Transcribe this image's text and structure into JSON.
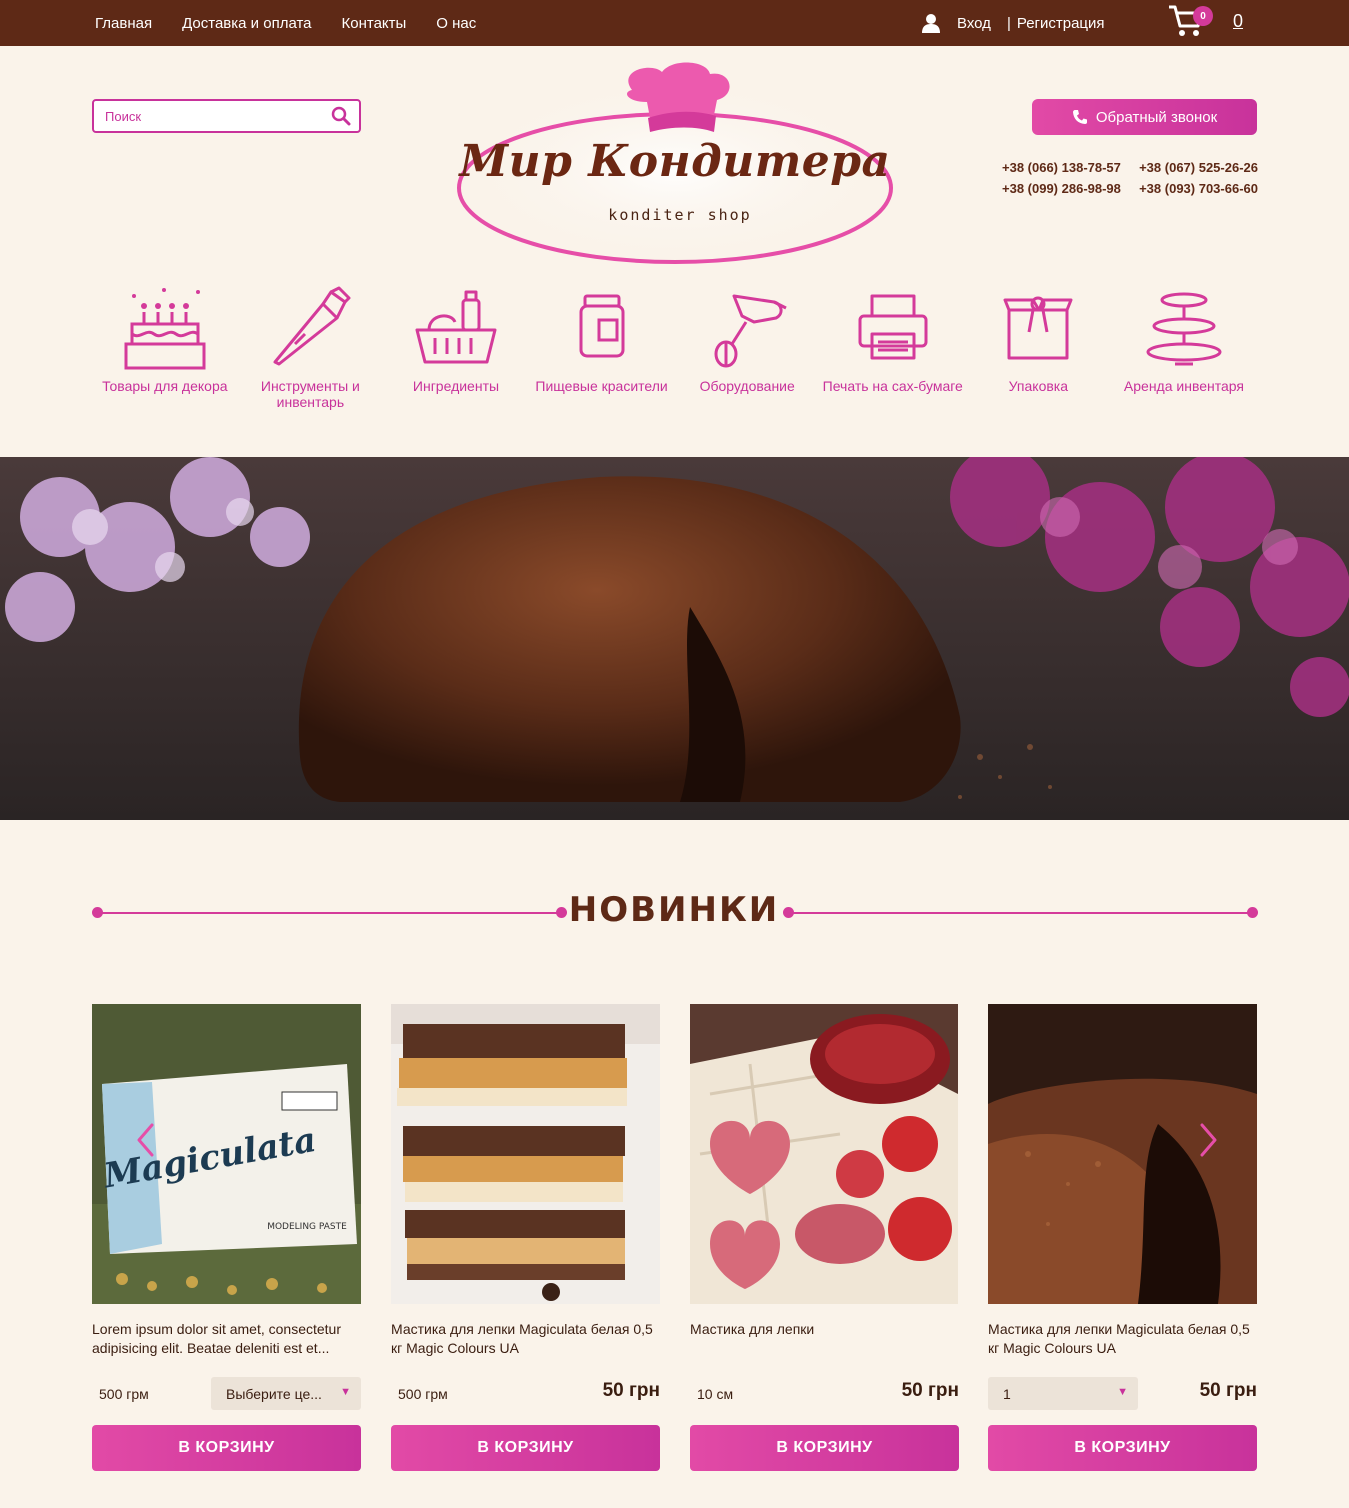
{
  "topnav": {
    "items": [
      "Главная",
      "Доставка и оплата",
      "Контакты",
      "О нас"
    ],
    "login": "Вход",
    "separator": "|",
    "register": "Регистрация",
    "cart_count": "0",
    "cart_total": "0"
  },
  "search": {
    "placeholder": "Поиск"
  },
  "logo": {
    "title": "Мир Кондитера",
    "subtitle": "konditer shop"
  },
  "callback": {
    "label": "Обратный звонок"
  },
  "phones": [
    "+38 (066) 138-78-57",
    "+38 (067) 525-26-26",
    "+38 (099) 286-98-98",
    "+38 (093) 703-66-60"
  ],
  "categories": [
    {
      "label": "Товары для декора",
      "icon": "cake-icon"
    },
    {
      "label": "Инструменты и инвентарь",
      "icon": "piping-bag-icon"
    },
    {
      "label": "Ингредиенты",
      "icon": "basket-icon"
    },
    {
      "label": "Пищевые красители",
      "icon": "jar-icon"
    },
    {
      "label": "Оборудование",
      "icon": "mixer-icon"
    },
    {
      "label": "Печать на сах-бумаге",
      "icon": "printer-icon"
    },
    {
      "label": "Упаковка",
      "icon": "gift-box-icon"
    },
    {
      "label": "Аренда инвентаря",
      "icon": "cake-stand-icon"
    }
  ],
  "section": {
    "title": "НОВИНКИ"
  },
  "products": [
    {
      "name": "Lorem ipsum dolor sit amet, consectetur adipisicing elit. Beatae deleniti est et...",
      "attr": "500 грм",
      "select": "Выберите це...",
      "price": "",
      "button": "В КОРЗИНУ"
    },
    {
      "name": "Мастика для лепки Magiculata белая 0,5 кг Magic Colours UA",
      "attr": "500 грм",
      "select": "",
      "price": "50 грн",
      "button": "В КОРЗИНУ"
    },
    {
      "name": "Мастика для лепки",
      "attr": "10 см",
      "select": "",
      "price": "50 грн",
      "button": "В КОРЗИНУ"
    },
    {
      "name": "Мастика для лепки Magiculata белая 0,5 кг Magic Colours UA",
      "attr": "",
      "select": "1",
      "price": "50 грн",
      "button": "В КОРЗИНУ"
    }
  ],
  "product_image_text": {
    "brand": "Magiculata",
    "sub": "MODELING PASTE"
  },
  "colors": {
    "topbar": "#5e2916",
    "accent": "#d43a9a",
    "background": "#faf3ea"
  }
}
